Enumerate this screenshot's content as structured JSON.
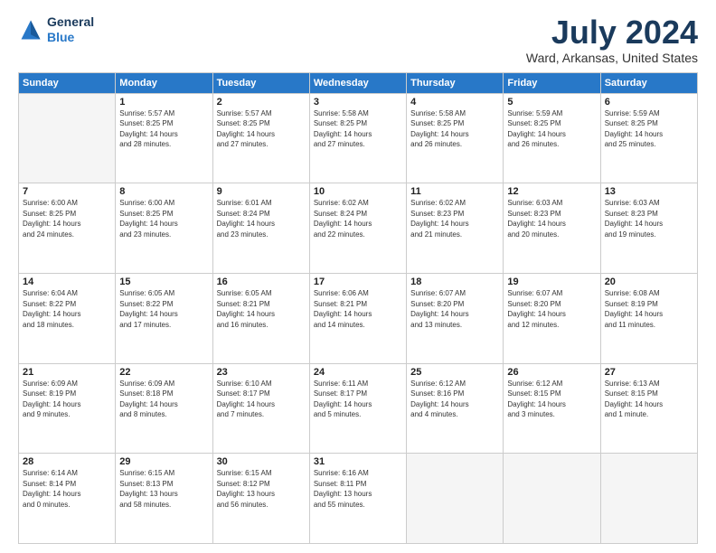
{
  "logo": {
    "line1": "General",
    "line2": "Blue"
  },
  "title": "July 2024",
  "subtitle": "Ward, Arkansas, United States",
  "days_of_week": [
    "Sunday",
    "Monday",
    "Tuesday",
    "Wednesday",
    "Thursday",
    "Friday",
    "Saturday"
  ],
  "weeks": [
    [
      {
        "day": "",
        "info": ""
      },
      {
        "day": "1",
        "info": "Sunrise: 5:57 AM\nSunset: 8:25 PM\nDaylight: 14 hours\nand 28 minutes."
      },
      {
        "day": "2",
        "info": "Sunrise: 5:57 AM\nSunset: 8:25 PM\nDaylight: 14 hours\nand 27 minutes."
      },
      {
        "day": "3",
        "info": "Sunrise: 5:58 AM\nSunset: 8:25 PM\nDaylight: 14 hours\nand 27 minutes."
      },
      {
        "day": "4",
        "info": "Sunrise: 5:58 AM\nSunset: 8:25 PM\nDaylight: 14 hours\nand 26 minutes."
      },
      {
        "day": "5",
        "info": "Sunrise: 5:59 AM\nSunset: 8:25 PM\nDaylight: 14 hours\nand 26 minutes."
      },
      {
        "day": "6",
        "info": "Sunrise: 5:59 AM\nSunset: 8:25 PM\nDaylight: 14 hours\nand 25 minutes."
      }
    ],
    [
      {
        "day": "7",
        "info": ""
      },
      {
        "day": "8",
        "info": "Sunrise: 6:00 AM\nSunset: 8:25 PM\nDaylight: 14 hours\nand 23 minutes."
      },
      {
        "day": "9",
        "info": "Sunrise: 6:01 AM\nSunset: 8:24 PM\nDaylight: 14 hours\nand 23 minutes."
      },
      {
        "day": "10",
        "info": "Sunrise: 6:02 AM\nSunset: 8:24 PM\nDaylight: 14 hours\nand 22 minutes."
      },
      {
        "day": "11",
        "info": "Sunrise: 6:02 AM\nSunset: 8:23 PM\nDaylight: 14 hours\nand 21 minutes."
      },
      {
        "day": "12",
        "info": "Sunrise: 6:03 AM\nSunset: 8:23 PM\nDaylight: 14 hours\nand 20 minutes."
      },
      {
        "day": "13",
        "info": "Sunrise: 6:03 AM\nSunset: 8:23 PM\nDaylight: 14 hours\nand 19 minutes."
      }
    ],
    [
      {
        "day": "14",
        "info": ""
      },
      {
        "day": "15",
        "info": "Sunrise: 6:05 AM\nSunset: 8:22 PM\nDaylight: 14 hours\nand 17 minutes."
      },
      {
        "day": "16",
        "info": "Sunrise: 6:05 AM\nSunset: 8:21 PM\nDaylight: 14 hours\nand 16 minutes."
      },
      {
        "day": "17",
        "info": "Sunrise: 6:06 AM\nSunset: 8:21 PM\nDaylight: 14 hours\nand 14 minutes."
      },
      {
        "day": "18",
        "info": "Sunrise: 6:07 AM\nSunset: 8:20 PM\nDaylight: 14 hours\nand 13 minutes."
      },
      {
        "day": "19",
        "info": "Sunrise: 6:07 AM\nSunset: 8:20 PM\nDaylight: 14 hours\nand 12 minutes."
      },
      {
        "day": "20",
        "info": "Sunrise: 6:08 AM\nSunset: 8:19 PM\nDaylight: 14 hours\nand 11 minutes."
      }
    ],
    [
      {
        "day": "21",
        "info": ""
      },
      {
        "day": "22",
        "info": "Sunrise: 6:09 AM\nSunset: 8:18 PM\nDaylight: 14 hours\nand 8 minutes."
      },
      {
        "day": "23",
        "info": "Sunrise: 6:10 AM\nSunset: 8:17 PM\nDaylight: 14 hours\nand 7 minutes."
      },
      {
        "day": "24",
        "info": "Sunrise: 6:11 AM\nSunset: 8:17 PM\nDaylight: 14 hours\nand 5 minutes."
      },
      {
        "day": "25",
        "info": "Sunrise: 6:12 AM\nSunset: 8:16 PM\nDaylight: 14 hours\nand 4 minutes."
      },
      {
        "day": "26",
        "info": "Sunrise: 6:12 AM\nSunset: 8:15 PM\nDaylight: 14 hours\nand 3 minutes."
      },
      {
        "day": "27",
        "info": "Sunrise: 6:13 AM\nSunset: 8:15 PM\nDaylight: 14 hours\nand 1 minute."
      }
    ],
    [
      {
        "day": "28",
        "info": "Sunrise: 6:14 AM\nSunset: 8:14 PM\nDaylight: 14 hours\nand 0 minutes."
      },
      {
        "day": "29",
        "info": "Sunrise: 6:15 AM\nSunset: 8:13 PM\nDaylight: 13 hours\nand 58 minutes."
      },
      {
        "day": "30",
        "info": "Sunrise: 6:15 AM\nSunset: 8:12 PM\nDaylight: 13 hours\nand 56 minutes."
      },
      {
        "day": "31",
        "info": "Sunrise: 6:16 AM\nSunset: 8:11 PM\nDaylight: 13 hours\nand 55 minutes."
      },
      {
        "day": "",
        "info": ""
      },
      {
        "day": "",
        "info": ""
      },
      {
        "day": "",
        "info": ""
      }
    ]
  ],
  "week1_sunday": "Sunrise: 6:00 AM\nSunset: 8:25 PM\nDaylight: 14 hours\nand 24 minutes.",
  "week3_sunday": "Sunrise: 6:04 AM\nSunset: 8:22 PM\nDaylight: 14 hours\nand 18 minutes.",
  "week4_sunday": "Sunrise: 6:09 AM\nSunset: 8:19 PM\nDaylight: 14 hours\nand 9 minutes."
}
